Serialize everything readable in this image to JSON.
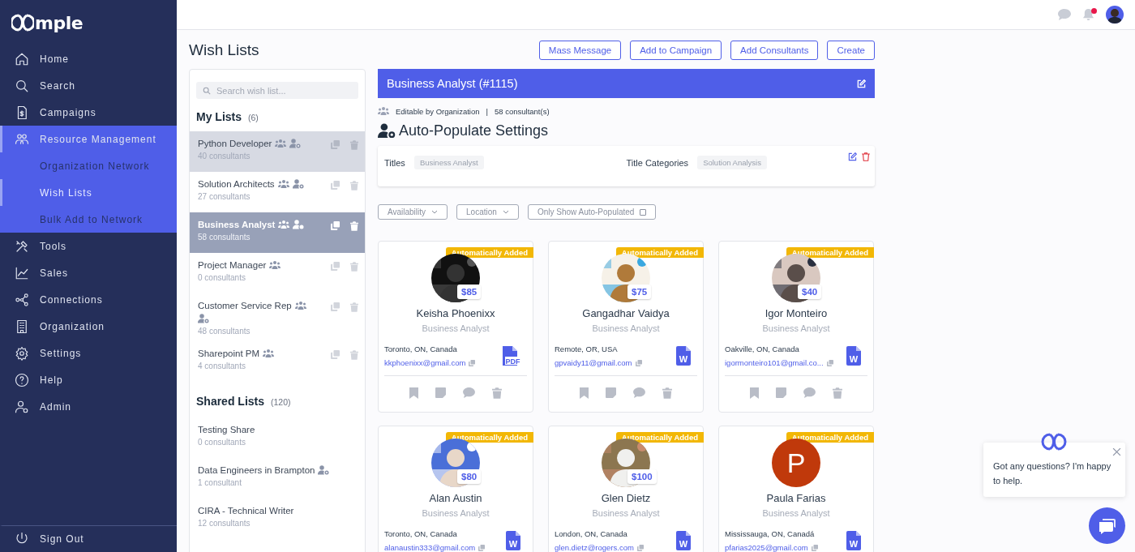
{
  "brand": {
    "name": "mple"
  },
  "sidebar": {
    "items": [
      {
        "label": "Home",
        "selected": false
      },
      {
        "label": "Search",
        "selected": false
      },
      {
        "label": "Campaigns",
        "selected": false
      },
      {
        "label": "Resource Management",
        "selected": true,
        "expanded": true,
        "children": [
          {
            "label": "Organization Network",
            "selected": false
          },
          {
            "label": "Wish Lists",
            "selected": true
          },
          {
            "label": "Bulk Add to Network",
            "selected": false
          }
        ]
      },
      {
        "label": "Tools",
        "selected": false
      },
      {
        "label": "Sales",
        "selected": false
      },
      {
        "label": "Connections",
        "selected": false
      },
      {
        "label": "Organization",
        "selected": false
      },
      {
        "label": "Settings",
        "selected": false
      },
      {
        "label": "Help",
        "selected": false
      },
      {
        "label": "Admin",
        "selected": false
      }
    ],
    "sign_out": "Sign Out"
  },
  "header": {
    "unread": true
  },
  "page": {
    "title": "Wish Lists",
    "actions": [
      "Mass Message",
      "Add to Campaign",
      "Add Consultants",
      "Create"
    ]
  },
  "lists_panel": {
    "search": {
      "placeholder": "Search wish list..."
    },
    "sections": [
      {
        "title": "My Lists",
        "count": "(6)",
        "items": [
          {
            "name": "Python Developer",
            "count": "40 consultants",
            "shared": true,
            "auto": true,
            "manageable": true,
            "selected": false,
            "highlighted": true
          },
          {
            "name": "Solution Architects",
            "count": "27 consultants",
            "shared": true,
            "auto": true,
            "manageable": true,
            "selected": false,
            "highlighted": false
          },
          {
            "name": "Business Analyst",
            "count": "58 consultants",
            "shared": true,
            "auto": true,
            "manageable": true,
            "selected": true,
            "highlighted": false
          },
          {
            "name": "Project Manager",
            "count": "0 consultants",
            "shared": true,
            "auto": false,
            "manageable": true,
            "selected": false,
            "highlighted": false
          },
          {
            "name": "Customer Service Rep",
            "count": "48 consultants",
            "shared": true,
            "auto": true,
            "manageable": true,
            "selected": false,
            "highlighted": false
          },
          {
            "name": "Sharepoint PM",
            "count": "4 consultants",
            "shared": true,
            "auto": false,
            "manageable": true,
            "selected": false,
            "highlighted": false
          }
        ]
      },
      {
        "title": "Shared Lists",
        "count": "(120)",
        "items": [
          {
            "name": "Testing Share",
            "count": "0 consultants",
            "shared": false,
            "auto": false,
            "manageable": false,
            "selected": false,
            "highlighted": false
          },
          {
            "name": "Data Engineers in Brampton",
            "count": "1 consultant",
            "shared": false,
            "auto": true,
            "manageable": false,
            "selected": false,
            "highlighted": false
          },
          {
            "name": "CIRA - Technical Writer",
            "count": "12 consultants",
            "shared": false,
            "auto": false,
            "manageable": false,
            "selected": false,
            "highlighted": false
          }
        ]
      }
    ]
  },
  "detail": {
    "title": "Business Analyst (#1115)",
    "editable_by": "Editable by Organization",
    "separator": "|",
    "consultants": "58 consultant(s)",
    "auto_settings": {
      "heading": "Auto-Populate Settings",
      "fields": [
        {
          "label": "Titles",
          "value": "Business Analyst"
        },
        {
          "label": "Title Categories",
          "value": "Solution Analysis"
        }
      ]
    },
    "filters": [
      {
        "kind": "dropdown",
        "label": "Availability"
      },
      {
        "kind": "dropdown",
        "label": "Location"
      },
      {
        "kind": "checkbox",
        "label": "Only Show Auto-Populated",
        "checked": false
      }
    ],
    "cards": [
      {
        "badge": "Automatically Added",
        "rate": "$85",
        "name": "Keisha Phoenixx",
        "title": "Business Analyst",
        "location": "Toronto, ON, Canada",
        "email": "kkphoenixx@gmail.com",
        "resume": {
          "kind": "pdf",
          "label": "PDF"
        }
      },
      {
        "badge": "Automatically Added",
        "rate": "$75",
        "name": "Gangadhar Vaidya",
        "title": "Business Analyst",
        "location": "Remote, OR, USA",
        "email": "gpvaidy11@gmail.com",
        "resume": {
          "kind": "word",
          "label": "W"
        }
      },
      {
        "badge": "Automatically Added",
        "rate": "$40",
        "name": "Igor Monteiro",
        "title": "Business Analyst",
        "location": "Oakville, ON, Canada",
        "email": "igormonteiro101@gmail.co...",
        "resume": {
          "kind": "word",
          "label": "W"
        }
      },
      {
        "badge": "Automatically Added",
        "rate": "$80",
        "name": "Alan Austin",
        "title": "Business Analyst",
        "location": "Toronto, ON, Canada",
        "email": "alanaustin333@gmail.com",
        "resume": {
          "kind": "word",
          "label": "W"
        }
      },
      {
        "badge": "Automatically Added",
        "rate": "$100",
        "name": "Glen Dietz",
        "title": "Business Analyst",
        "location": "London, ON, Canada",
        "email": "glen.dietz@rogers.com",
        "resume": {
          "kind": "word",
          "label": "W"
        }
      },
      {
        "badge": "Automatically Added",
        "avatar": {
          "kind": "letter",
          "letter": "P",
          "color": "#c0390b"
        },
        "name": "Paula Farias",
        "title": "Business Analyst",
        "location": "Mississauga, ON, Canadá",
        "email": "pfarias2025@gmail.com",
        "resume": {
          "kind": "word",
          "label": "W"
        }
      }
    ]
  },
  "chat": {
    "message": "Got any questions? I'm happy to help."
  }
}
